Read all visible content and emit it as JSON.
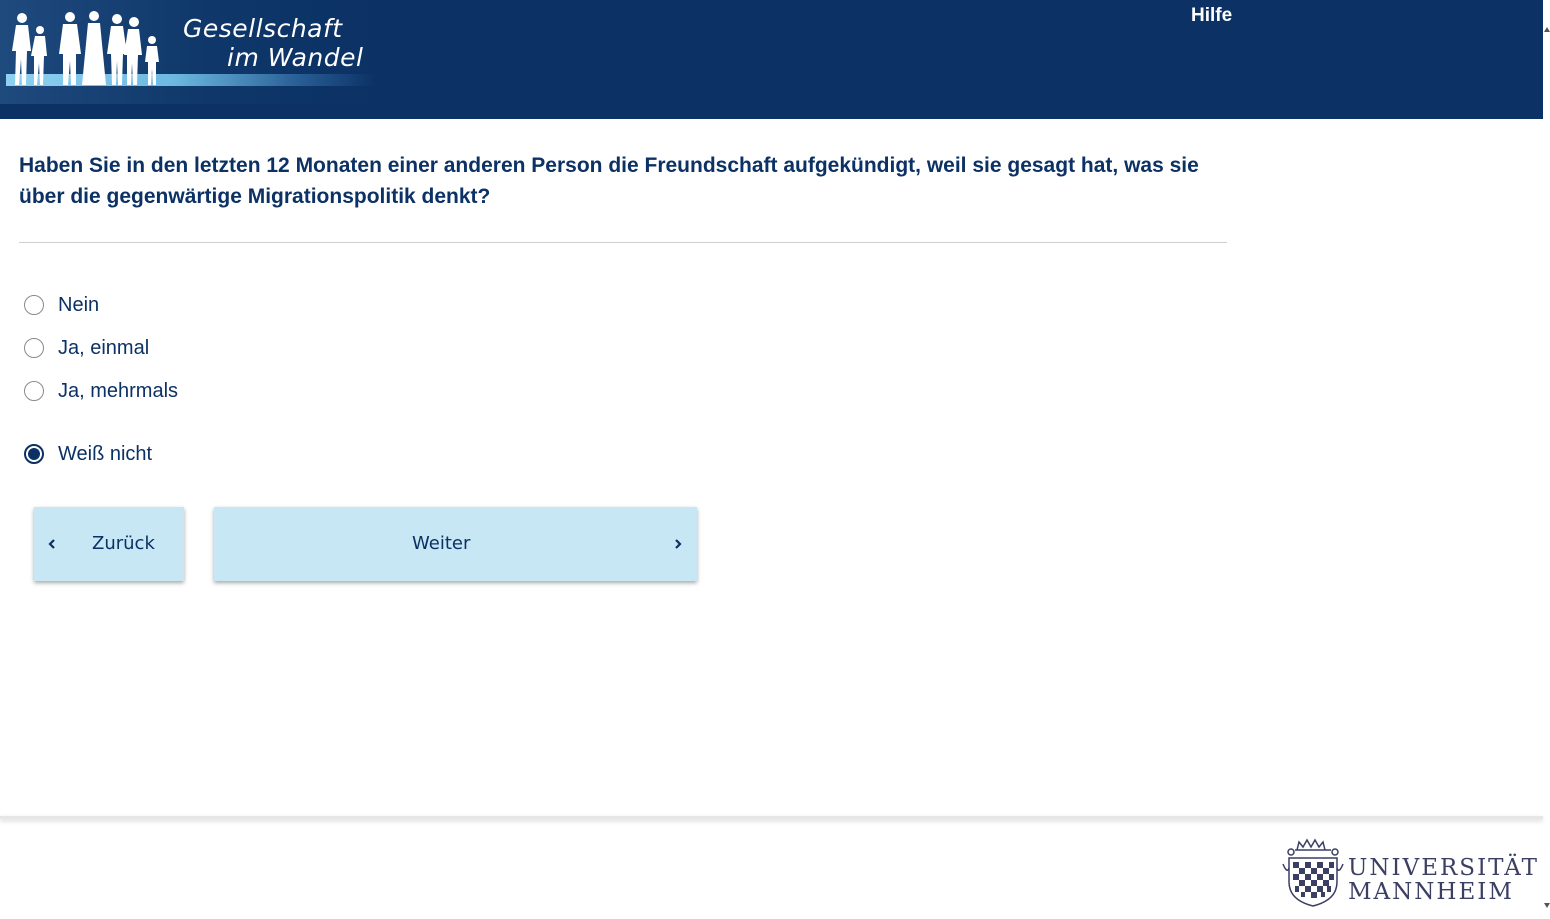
{
  "header": {
    "logo_line1": "Gesellschaft",
    "logo_line2": "im Wandel",
    "help_link": "Hilfe"
  },
  "question": {
    "text": "Haben Sie in den letzten 12 Monaten einer anderen Person die Freundschaft aufgekündigt, weil sie gesagt hat, was sie über die gegenwärtige Migrationspolitik denkt?"
  },
  "options": [
    {
      "label": "Nein",
      "selected": false
    },
    {
      "label": "Ja, einmal",
      "selected": false
    },
    {
      "label": "Ja, mehrmals",
      "selected": false
    },
    {
      "label": "Weiß nicht",
      "selected": true
    }
  ],
  "navigation": {
    "back_label": "Zurück",
    "next_label": "Weiter"
  },
  "footer": {
    "university_line1": "UNIVERSITÄT",
    "university_line2": "MANNHEIM"
  },
  "colors": {
    "brand_navy": "#0b3165",
    "button_bg": "#c6e7f3"
  }
}
